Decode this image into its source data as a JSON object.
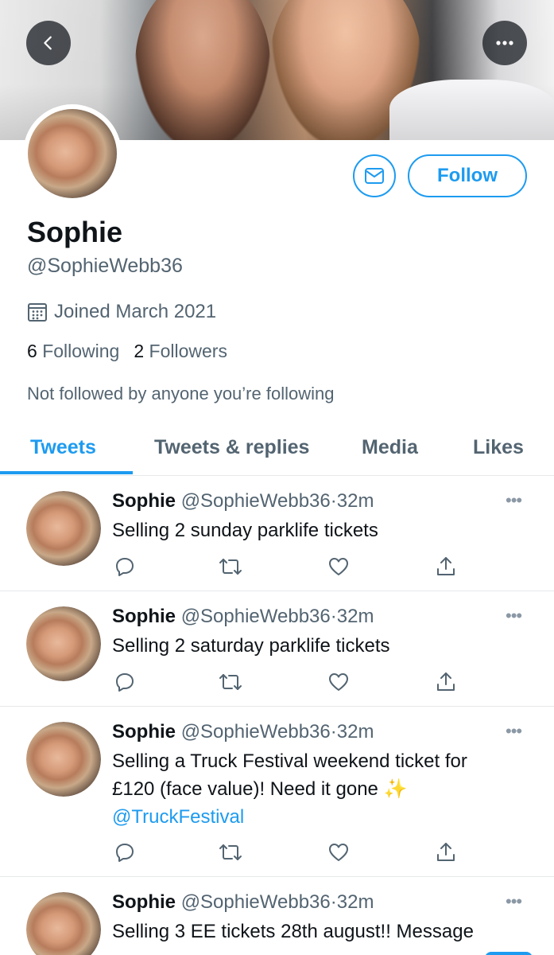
{
  "header": {
    "back_icon": "chevron-left-icon",
    "more_icon": "ellipsis-icon"
  },
  "profile": {
    "name": "Sophie",
    "handle": "@SophieWebb36",
    "joined": "Joined March 2021",
    "following_count": "6",
    "following_label": "Following",
    "followers_count": "2",
    "followers_label": "Followers",
    "not_followed": "Not followed by anyone you’re following",
    "follow_label": "Follow",
    "message_icon": "mail-icon"
  },
  "tabs": [
    {
      "label": "Tweets",
      "active": true
    },
    {
      "label": "Tweets & replies",
      "active": false
    },
    {
      "label": "Media",
      "active": false
    },
    {
      "label": "Likes",
      "active": false
    }
  ],
  "tweets": [
    {
      "name": "Sophie",
      "handle": "@SophieWebb36",
      "sep": "·",
      "time": "32m",
      "text": "Selling 2 sunday parklife tickets"
    },
    {
      "name": "Sophie",
      "handle": "@SophieWebb36",
      "sep": "·",
      "time": "32m",
      "text": "Selling 2 saturday parklife tickets"
    },
    {
      "name": "Sophie",
      "handle": "@SophieWebb36",
      "sep": "·",
      "time": "32m",
      "text_line1": "Selling a Truck Festival weekend ticket for",
      "text_line2": "£120 (face value)! Need it gone ✨",
      "mention": "@TruckFestival"
    },
    {
      "name": "Sophie",
      "handle": "@SophieWebb36",
      "sep": "·",
      "time": "32m",
      "text": "Selling 3 EE tickets 28th august!! Message"
    }
  ],
  "colors": {
    "accent": "#1d9bf0",
    "secondary_text": "#536471",
    "divider": "#e6e8ea"
  }
}
